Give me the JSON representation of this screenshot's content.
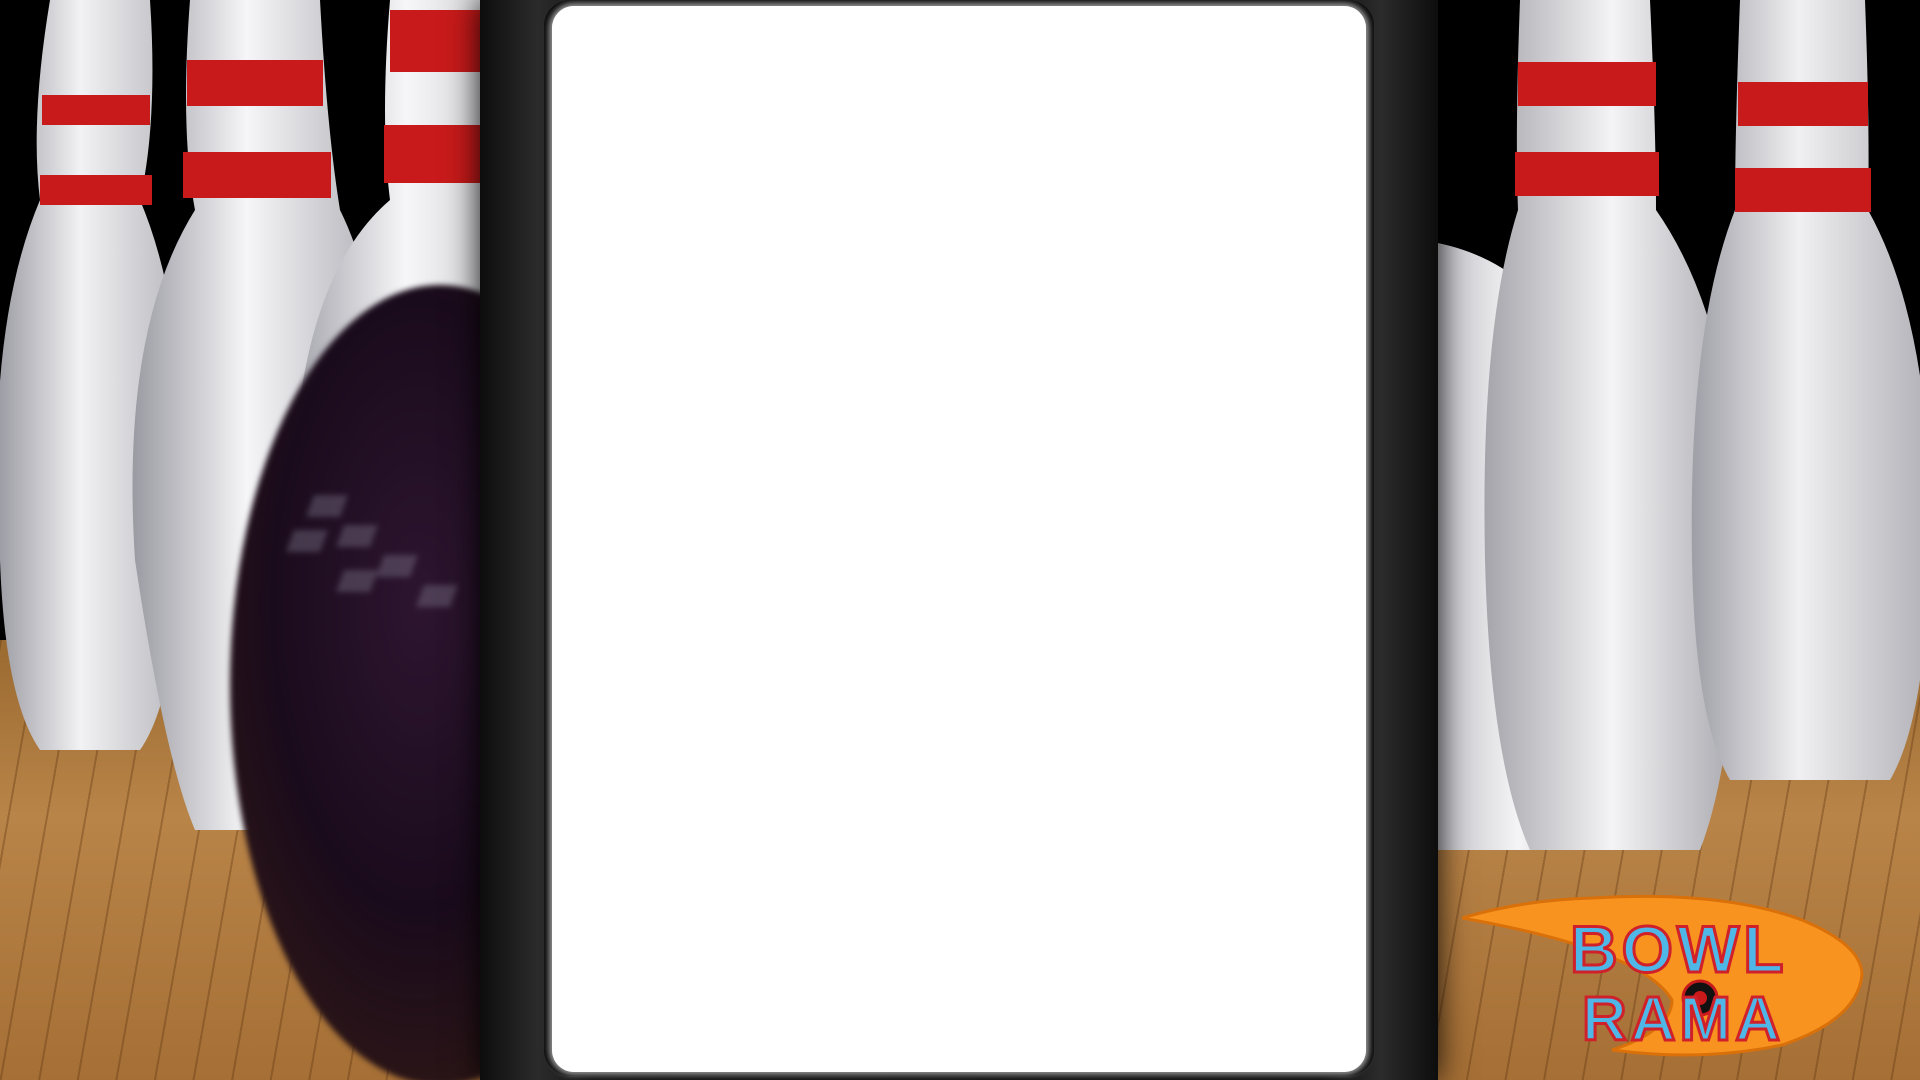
{
  "logo": {
    "line1": "BOWL",
    "line2": "RAMA"
  },
  "colors": {
    "screen": "#ffffff",
    "cabinet": "#151515",
    "pin_stripe": "#c81a1a",
    "logo_swoosh": "#f7931e",
    "logo_text": "#4fb6e8",
    "floor": "#b98448"
  }
}
